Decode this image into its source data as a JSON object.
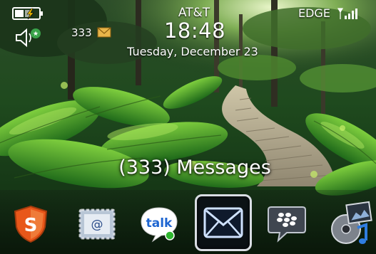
{
  "status": {
    "carrier": "AT&T",
    "time": "18:48",
    "date": "Tuesday, December 23",
    "network": "EDGE",
    "unread_count": "333",
    "icons": [
      "battery-charging-icon",
      "speaker-icon",
      "envelope-icon",
      "signal-strength-icon"
    ]
  },
  "focus_label": "(333) Messages",
  "dock": {
    "items": [
      {
        "icon": "security-shield-icon",
        "label": "S"
      },
      {
        "icon": "email-setup-icon",
        "label": "@"
      },
      {
        "icon": "google-talk-icon",
        "label": "talk"
      },
      {
        "icon": "messages-icon",
        "label": ""
      },
      {
        "icon": "blackberry-messenger-icon",
        "label": ""
      },
      {
        "icon": "media-icon",
        "label": ""
      }
    ],
    "focused_index": 3
  },
  "colors": {
    "focus_border": "#d9dde3",
    "shield": "#e8571a",
    "talk_green": "#2fb52f",
    "status_text": "#ffffff"
  }
}
